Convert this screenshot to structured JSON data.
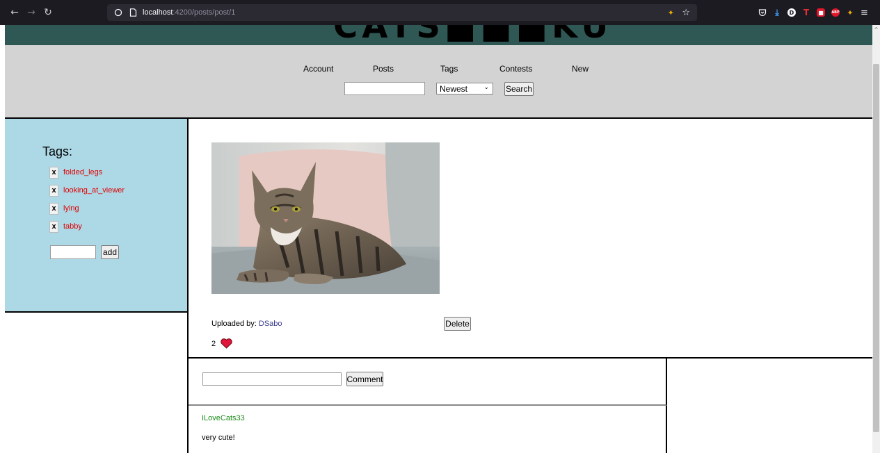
{
  "browser": {
    "url_host": "localhost",
    "url_path": ":4200/posts/post/1"
  },
  "site": {
    "logo_text": "CATS■■■KU"
  },
  "nav": {
    "items": [
      {
        "label": "Account"
      },
      {
        "label": "Posts"
      },
      {
        "label": "Tags"
      },
      {
        "label": "Contests"
      },
      {
        "label": "New"
      }
    ],
    "search_value": "",
    "sort_selected": "Newest",
    "search_button": "Search"
  },
  "sidebar": {
    "title": "Tags:",
    "remove_label": "x",
    "tags": [
      {
        "name": "folded_legs"
      },
      {
        "name": "looking_at_viewer"
      },
      {
        "name": "lying"
      },
      {
        "name": "tabby"
      }
    ],
    "add_input_value": "",
    "add_button": "add"
  },
  "post": {
    "uploaded_label": "Uploaded by:",
    "uploader": "DSabo",
    "delete_button": "Delete",
    "like_count": "2"
  },
  "comments": {
    "input_value": "",
    "submit_button": "Comment",
    "items": [
      {
        "author": "ILoveCats33",
        "text": "very cute!"
      }
    ]
  },
  "colors": {
    "banner": "#2f5754",
    "header": "#d3d3d3",
    "sidebar": "#add8e6",
    "tag_link": "#e00000",
    "comment_author": "#1a8a1a",
    "heart": "#e0163a"
  }
}
